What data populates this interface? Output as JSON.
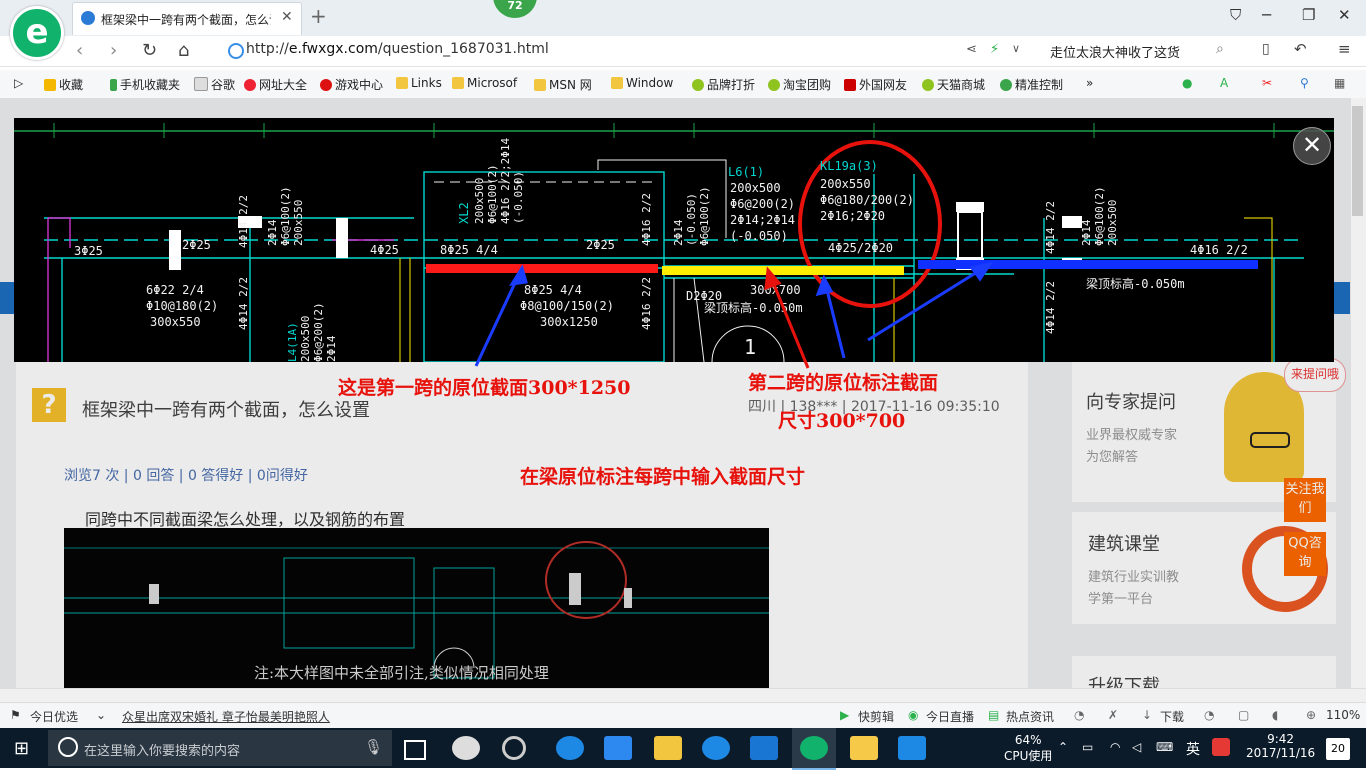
{
  "browser": {
    "tab_title": "框架梁中一跨有两个截面，怎么设",
    "badge_count": "72",
    "url_prefix": "http://",
    "url_domain": "e.fwxgx.com",
    "url_path": "/question_1687031.html",
    "addr_right_text": "走位太浪大神收了这货"
  },
  "favorites": [
    "收藏",
    "手机收藏夹",
    "谷歌",
    "网址大全",
    "游戏中心",
    "Links",
    "Microsof",
    "MSN 网",
    "Window",
    "品牌打折",
    "淘宝团购",
    "外国网友",
    "天猫商城",
    "精准控制"
  ],
  "page": {
    "question_title": "框架梁中一跨有两个截面，怎么设置",
    "question_meta": "四川 | 138*** | 2017-11-16 09:35:10",
    "stats": "浏览7 次 | 0 回答 | 0 答得好 | 0问得好",
    "body_text": "同跨中不同截面梁怎么处理，以及钢筋的布置",
    "thumb_note": "注:本大样图中未全部引注,类似情况相同处理",
    "side1_title": "向专家提问",
    "side1_sub1": "业界最权威专家",
    "side1_sub2": "为您解答",
    "side1_bubble": "来提问哦",
    "side2_title": "建筑课堂",
    "side2_sub1": "建筑行业实训教",
    "side2_sub2": "学第一平台",
    "side3_title": "升级下载",
    "follow_btn": "关注我们",
    "qq_btn": "QQ咨询"
  },
  "annotations": {
    "first_span": "这是第一跨的原位截面300*1250",
    "second_span_1": "第二跨的原位标注截面",
    "second_span_2": "尺寸300*700",
    "instruction": "在梁原位标注每跨中输入截面尺寸"
  },
  "cad": {
    "L6_label": "L6(1)",
    "L6_size": "200x500",
    "L6_stirrup": "Φ6@200(2)",
    "L6_bars": "2Φ14;2Φ14",
    "L6_elev": "(-0.050)",
    "KL_label": "KL19a(3)",
    "KL_size": "200x550",
    "KL_stirrup": "Φ6@180/200(2)",
    "KL_bars": "2Φ16;2Φ20",
    "span1_top": "8Φ25 4/4",
    "span1_bot": "8Φ25 4/4",
    "span1_stirrup": "Φ8@100/150(2)",
    "span1_size": "300x1250",
    "span2_size": "300x700",
    "span2_elev": "梁顶标高-0.050m",
    "span3_elev": "梁顶标高-0.050m",
    "left_a": "3Φ25",
    "left_b": "2Φ25",
    "left_c": "4Φ25",
    "left_bot1": "6Φ22 2/4",
    "left_bot2": "Φ10@180(2)",
    "left_bot3": "300x550",
    "mid_top": "2Φ25",
    "right_top": "4Φ25/2Φ20",
    "far_right": "4Φ16 2/2",
    "d2": "D2Φ20",
    "xl2": "XL2",
    "circle_num": "1"
  },
  "statusbar": {
    "left1": "今日优选",
    "news": "众星出席双宋婚礼 章子怡最美明艳照人",
    "r1": "快剪辑",
    "r2": "今日直播",
    "r3": "热点资讯",
    "r4": "下载",
    "zoom": "110%"
  },
  "taskbar": {
    "search_placeholder": "在这里输入你要搜索的内容",
    "cpu_pct": "64%",
    "cpu_label": "CPU使用",
    "ime": "英",
    "time": "9:42",
    "date": "2017/11/16",
    "notif": "20"
  },
  "colors": {
    "red_bar": "#ff1a1a",
    "yellow_bar": "#ffee00",
    "blue_bar": "#1030ff",
    "annotation_red": "#e8120c",
    "cad_cyan": "#00d8d0"
  }
}
